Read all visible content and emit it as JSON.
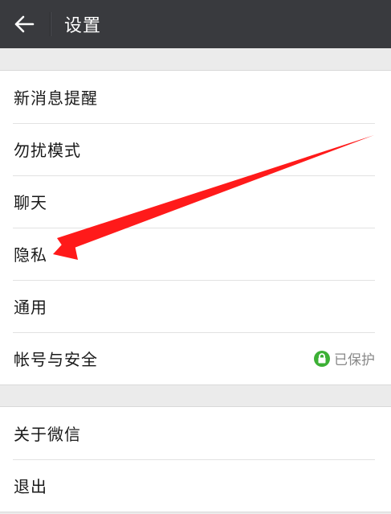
{
  "header": {
    "title": "设置",
    "back_icon": "arrow-left-icon"
  },
  "groups": [
    {
      "items": [
        {
          "label": "新消息提醒"
        },
        {
          "label": "勿扰模式"
        },
        {
          "label": "聊天"
        },
        {
          "label": "隐私"
        },
        {
          "label": "通用"
        },
        {
          "label": "帐号与安全",
          "status": "已保护",
          "status_icon": "lock-icon"
        }
      ]
    },
    {
      "items": [
        {
          "label": "关于微信"
        },
        {
          "label": "退出"
        }
      ]
    }
  ],
  "colors": {
    "header_bg": "#393a3e",
    "page_bg": "#ebebeb",
    "status_green": "#3cb035",
    "annotation_red": "#ff1a1a"
  }
}
